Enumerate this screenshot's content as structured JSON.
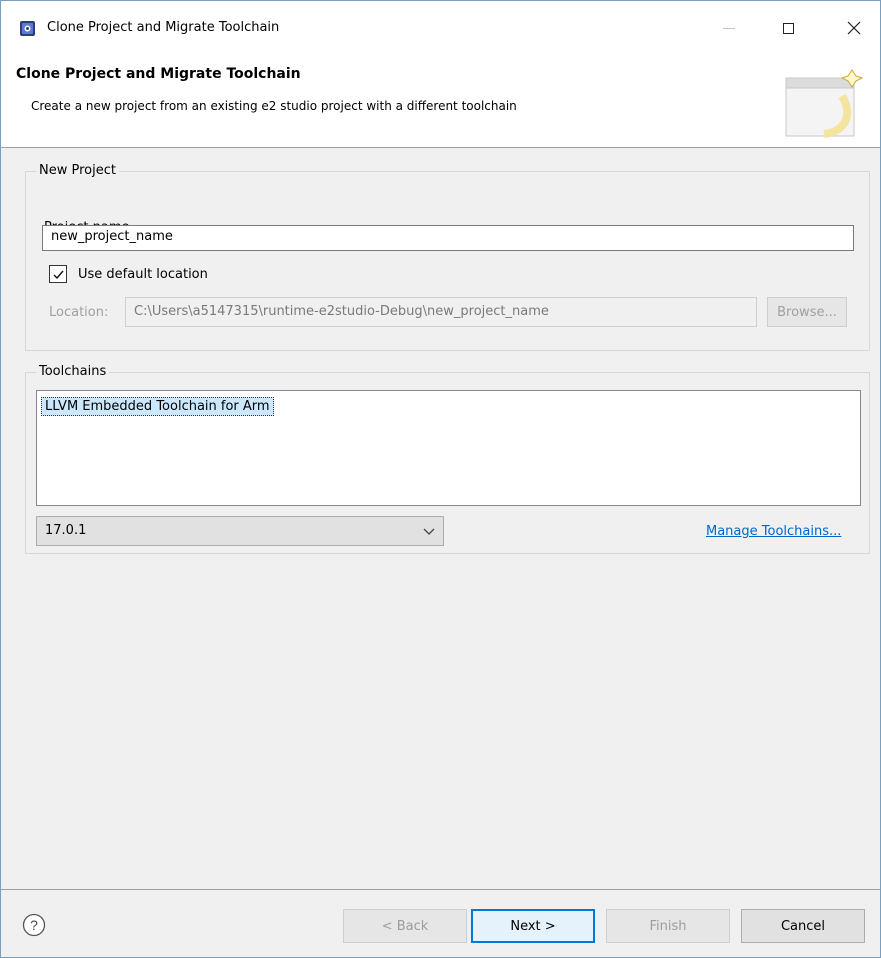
{
  "window": {
    "title": "Clone Project and Migrate Toolchain",
    "icon": "e2studio-app-icon",
    "controls": [
      "minimize-icon",
      "maximize-icon",
      "close-icon"
    ]
  },
  "banner": {
    "title": "Clone Project and Migrate Toolchain",
    "description": "Create a new project from an existing e2 studio project with a different toolchain"
  },
  "new_project": {
    "group_label": "New Project",
    "project_name_label": "Project name",
    "project_name_value": "new_project_name",
    "use_default_location_label": "Use default location",
    "use_default_location_checked": true,
    "location_label": "Location:",
    "location_value": "C:\\Users\\a5147315\\runtime-e2studio-Debug\\new_project_name",
    "browse_label": "Browse..."
  },
  "toolchains": {
    "group_label": "Toolchains",
    "items": [
      "LLVM Embedded Toolchain for Arm"
    ],
    "selected_item": "LLVM Embedded Toolchain for Arm",
    "version_selected": "17.0.1",
    "manage_link": "Manage Toolchains..."
  },
  "buttons": {
    "back": "< Back",
    "next": "Next >",
    "finish": "Finish",
    "cancel": "Cancel"
  },
  "colors": {
    "accent": "#0078d7",
    "link": "#0066cc",
    "selection": "#cce8ff",
    "background": "#f0f0f0"
  }
}
